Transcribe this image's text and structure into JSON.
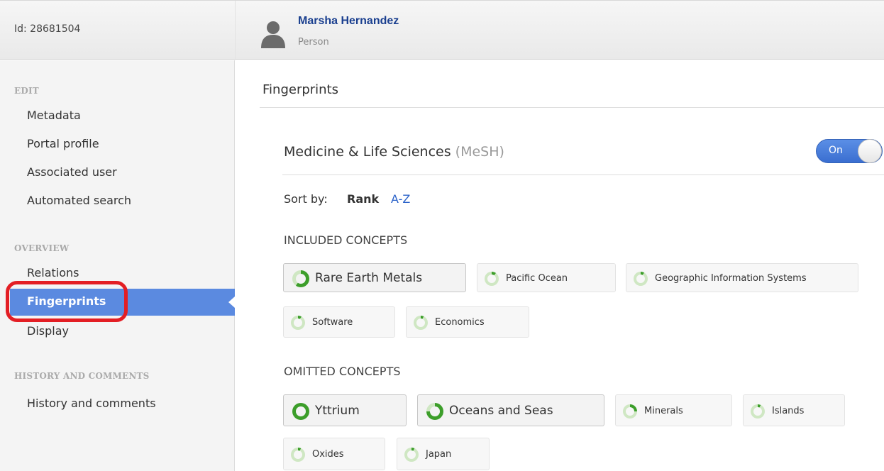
{
  "header": {
    "id_text": "Id: 28681504",
    "name": "Marsha Hernandez",
    "type": "Person"
  },
  "sidebar": {
    "sections": [
      {
        "heading": "EDIT",
        "items": [
          "Metadata",
          "Portal profile",
          "Associated user",
          "Automated search"
        ]
      },
      {
        "heading": "OVERVIEW",
        "items": [
          "Relations",
          "Fingerprints",
          "Display"
        ]
      },
      {
        "heading": "HISTORY AND COMMENTS",
        "items": [
          "History and comments"
        ]
      }
    ],
    "active_item": "Fingerprints"
  },
  "main": {
    "title": "Fingerprints",
    "section": {
      "title": "Medicine & Life Sciences",
      "subtitle": "(MeSH)",
      "toggle_label": "On",
      "toggle_on": true
    },
    "sort": {
      "label": "Sort by:",
      "options": [
        "Rank",
        "A-Z"
      ],
      "selected": "Rank"
    },
    "included_label": "INCLUDED CONCEPTS",
    "omitted_label": "OMITTED CONCEPTS",
    "included": [
      {
        "label": "Rare Earth Metals",
        "weight": 0.6
      },
      {
        "label": "Pacific Ocean",
        "weight": 0.1
      },
      {
        "label": "Geographic Information Systems",
        "weight": 0.08
      },
      {
        "label": "Software",
        "weight": 0.08
      },
      {
        "label": "Economics",
        "weight": 0.07
      }
    ],
    "omitted": [
      {
        "label": "Yttrium",
        "weight": 1.0
      },
      {
        "label": "Oceans and Seas",
        "weight": 0.75
      },
      {
        "label": "Minerals",
        "weight": 0.25
      },
      {
        "label": "Islands",
        "weight": 0.07
      },
      {
        "label": "Oxides",
        "weight": 0.07
      },
      {
        "label": "Japan",
        "weight": 0.07
      }
    ]
  },
  "colors": {
    "accent_blue": "#5b8ae0",
    "link_blue": "#2a62c9",
    "donut_green": "#3c9e2a",
    "donut_track": "#cfe7c3",
    "highlight_red": "#e31e24"
  }
}
